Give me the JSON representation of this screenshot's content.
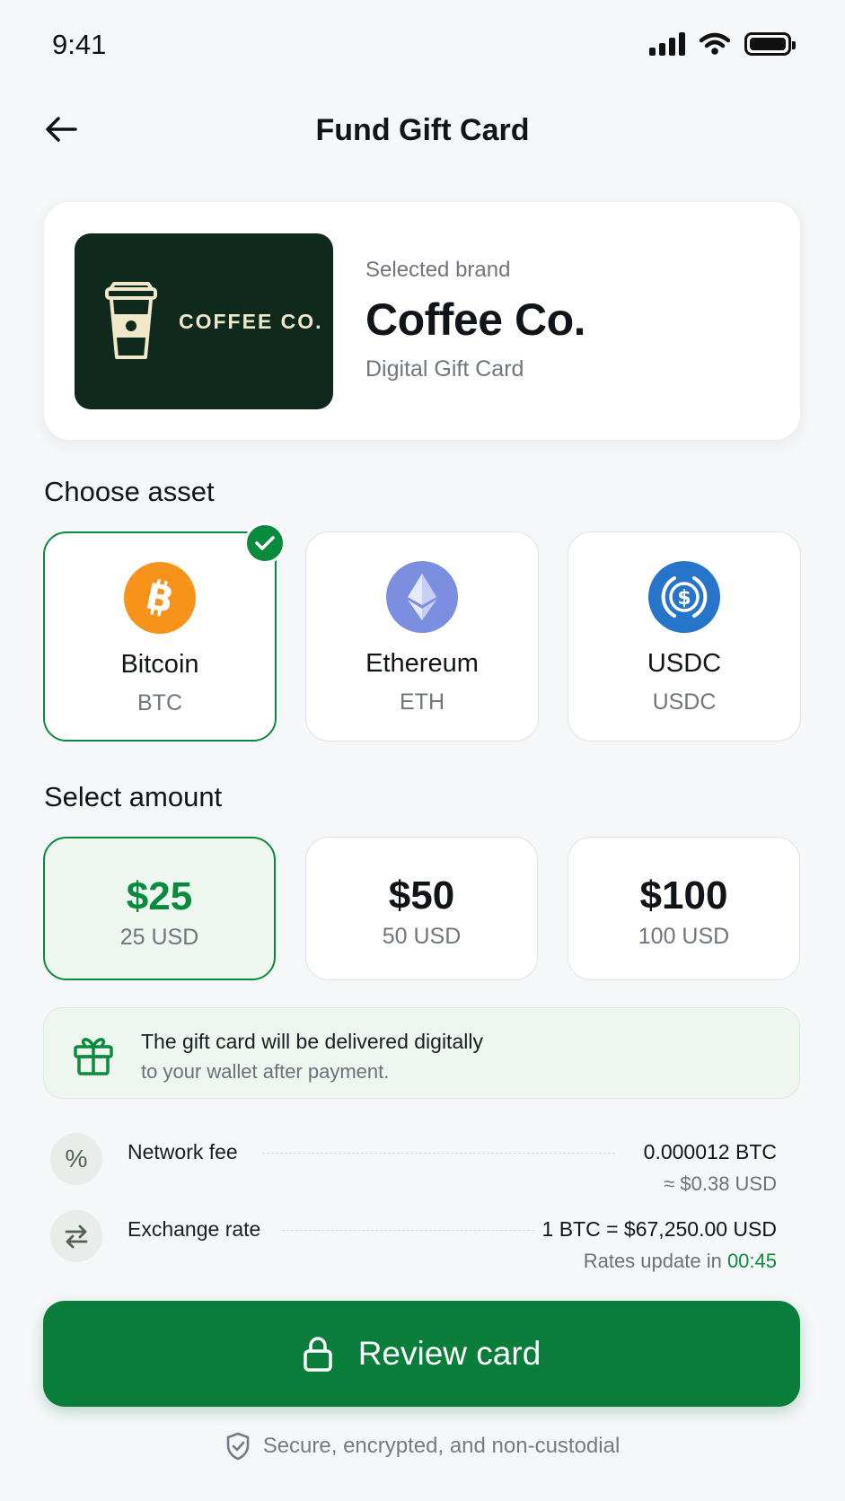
{
  "status_bar": {
    "time": "9:41"
  },
  "header": {
    "title": "Fund Gift Card"
  },
  "brand": {
    "art_text": "COFFEE CO.",
    "caption": "Selected brand",
    "name": "Coffee Co.",
    "type": "Digital Gift Card",
    "art_color": "#0f2a1c"
  },
  "sections": {
    "asset_label": "Choose asset",
    "amount_label": "Select amount"
  },
  "assets": [
    {
      "name": "Bitcoin",
      "code": "BTC",
      "icon": "bitcoin-icon",
      "color": "#f7931a",
      "selected": true
    },
    {
      "name": "Ethereum",
      "code": "ETH",
      "icon": "ethereum-icon",
      "color": "#7b8ee0",
      "selected": false
    },
    {
      "name": "USDC",
      "code": "USDC",
      "icon": "usdc-icon",
      "color": "#2775ca",
      "selected": false
    }
  ],
  "amounts": [
    {
      "value": "$25",
      "sub": "25 USD",
      "selected": true
    },
    {
      "value": "$50",
      "sub": "50 USD",
      "selected": false
    },
    {
      "value": "$100",
      "sub": "100 USD",
      "selected": false
    }
  ],
  "info": {
    "line1": "The gift card will be delivered digitally",
    "line2": "to your wallet after payment."
  },
  "fees": {
    "network_fee_label": "Network fee",
    "network_fee_value": "0.000012 BTC",
    "network_fee_usd": "≈ $0.38 USD",
    "exchange_label": "Exchange rate",
    "exchange_value": "1 BTC = $67,250.00 USD",
    "rates_prefix": "Rates update in",
    "rates_timer": "00:45"
  },
  "cta": {
    "label": "Review card"
  },
  "footer": {
    "secure_note": "Secure, encrypted, and non-custodial"
  },
  "colors": {
    "accent": "#0a8a3d",
    "button": "#0a7d3b"
  }
}
